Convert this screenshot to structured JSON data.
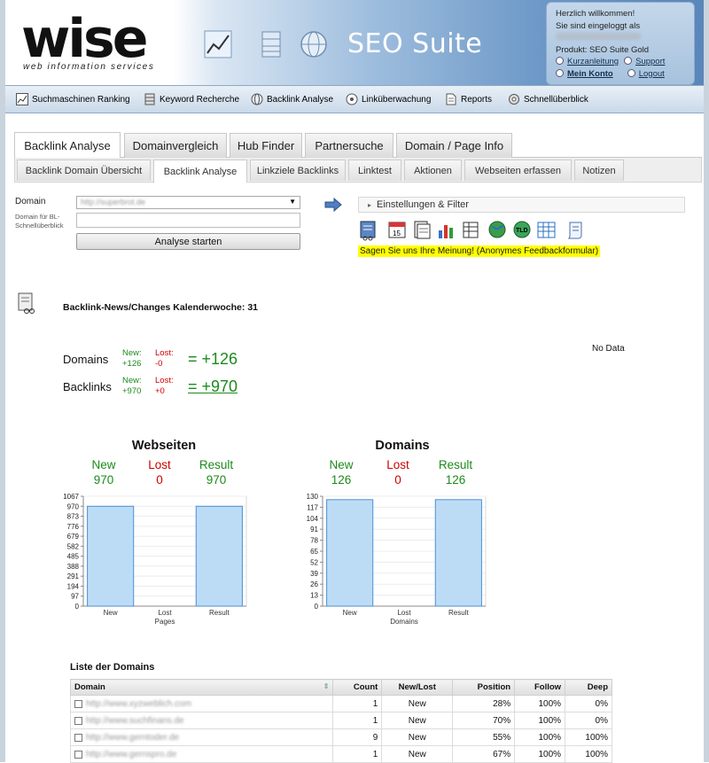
{
  "brand": {
    "logo_word": "wise",
    "logo_sub": "web information services",
    "suite_title": "SEO Suite"
  },
  "welcome": {
    "greeting": "Herzlich willkommen!",
    "logged_in": "Sie sind eingeloggt als",
    "product": "Produkt: SEO Suite Gold",
    "kurzanleitung": "Kurzanleitung",
    "support": "Support",
    "konto": "Mein Konto",
    "logout": "Logout"
  },
  "nav": [
    "Suchmaschinen Ranking",
    "Keyword Recherche",
    "Backlink Analyse",
    "Linküberwachung",
    "Reports",
    "Schnellüberblick"
  ],
  "tabs_main": [
    "Backlink Analyse",
    "Domainvergleich",
    "Hub Finder",
    "Partnersuche",
    "Domain / Page Info"
  ],
  "tabs_sub": [
    "Backlink Domain Übersicht",
    "Backlink Analyse",
    "Linkziele Backlinks",
    "Linktest",
    "Aktionen",
    "Webseiten erfassen",
    "Notizen"
  ],
  "form": {
    "domain_label": "Domain",
    "domain_value": "http://superbrot.de",
    "bl_label": "Domain für BL-Schnellüberblick",
    "button": "Analyse starten"
  },
  "filter": {
    "label": "Einstellungen & Filter",
    "feedback": "Sagen Sie uns Ihre Meinung! (Anonymes Feedbackformular)"
  },
  "news": {
    "title": "Backlink-News/Changes Kalenderwoche: 31",
    "nodata": "No Data"
  },
  "summary": {
    "domains": {
      "label": "Domains",
      "new_label": "New:",
      "new_val": "+126",
      "lost_label": "Lost:",
      "lost_val": "-0",
      "total": "= +126"
    },
    "backlinks": {
      "label": "Backlinks",
      "new_label": "New:",
      "new_val": "+970",
      "lost_label": "Lost:",
      "lost_val": "+0",
      "total": "= +970"
    }
  },
  "charts": [
    {
      "title": "Webseiten",
      "new_label": "New",
      "lost_label": "Lost",
      "result_label": "Result",
      "new": "970",
      "lost": "0",
      "result": "970",
      "sublabel": "Pages"
    },
    {
      "title": "Domains",
      "new_label": "New",
      "lost_label": "Lost",
      "result_label": "Result",
      "new": "126",
      "lost": "0",
      "result": "126",
      "sublabel": "Domains"
    }
  ],
  "chart_data": [
    {
      "type": "bar",
      "title": "Webseiten",
      "categories": [
        "New",
        "Lost",
        "Result"
      ],
      "values": [
        970,
        0,
        970
      ],
      "xlabel": "Pages",
      "ylim": [
        0,
        1067
      ],
      "yticks": [
        0,
        97,
        194,
        291,
        388,
        485,
        582,
        679,
        776,
        873,
        970,
        1067
      ]
    },
    {
      "type": "bar",
      "title": "Domains",
      "categories": [
        "New",
        "Lost",
        "Result"
      ],
      "values": [
        126,
        0,
        126
      ],
      "xlabel": "Domains",
      "ylim": [
        0,
        130
      ],
      "yticks": [
        0,
        13,
        26,
        39,
        52,
        65,
        78,
        91,
        104,
        117,
        130
      ]
    }
  ],
  "table": {
    "title": "Liste der Domains",
    "headers": [
      "Domain",
      "Count",
      "New/Lost",
      "Position",
      "Follow",
      "Deep"
    ],
    "rows": [
      {
        "domain": "http://www.xyzweblich.com",
        "count": "1",
        "newlost": "New",
        "position": "28%",
        "follow": "100%",
        "deep": "0%"
      },
      {
        "domain": "http://www.suchfinans.de",
        "count": "1",
        "newlost": "New",
        "position": "70%",
        "follow": "100%",
        "deep": "0%"
      },
      {
        "domain": "http://www.gerntoder.de",
        "count": "9",
        "newlost": "New",
        "position": "55%",
        "follow": "100%",
        "deep": "100%"
      },
      {
        "domain": "http://www.gernspro.de",
        "count": "1",
        "newlost": "New",
        "position": "67%",
        "follow": "100%",
        "deep": "100%"
      }
    ]
  }
}
